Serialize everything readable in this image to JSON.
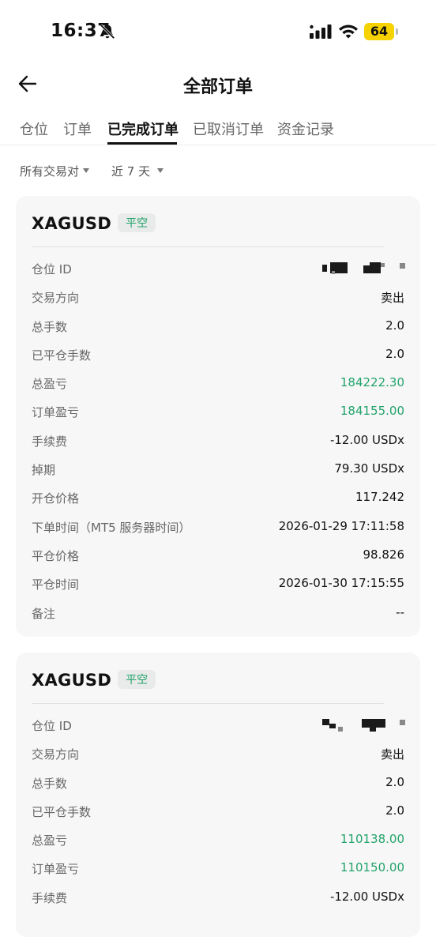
{
  "status_bar": {
    "time": "16:37",
    "battery": "64",
    "icons": [
      "bell-muted-icon",
      "signal-icon",
      "wifi-icon",
      "battery-icon"
    ]
  },
  "header": {
    "title": "全部订单",
    "back_icon": "arrow-left-icon"
  },
  "tabs": [
    {
      "label": "仓位",
      "active": false
    },
    {
      "label": "订单",
      "active": false
    },
    {
      "label": "已完成订单",
      "active": true
    },
    {
      "label": "已取消订单",
      "active": false
    },
    {
      "label": "资金记录",
      "active": false
    }
  ],
  "filters": {
    "pair": "所有交易对",
    "period": "近 7 天"
  },
  "colors": {
    "profit_green": "#22a36a",
    "battery_yellow": "#f5d200",
    "card_bg": "#f7f7f7"
  },
  "cards": [
    {
      "symbol": "XAGUSD",
      "badge": "平空",
      "rows": [
        {
          "label": "仓位 ID",
          "value": ""
        },
        {
          "label": "交易方向",
          "value": "卖出"
        },
        {
          "label": "总手数",
          "value": "2.0"
        },
        {
          "label": "已平仓手数",
          "value": "2.0"
        },
        {
          "label": "总盈亏",
          "value": "184222.30"
        },
        {
          "label": "订单盈亏",
          "value": "184155.00"
        },
        {
          "label": "手续费",
          "value": "-12.00 USDx"
        },
        {
          "label": "掉期",
          "value": "79.30 USDx"
        },
        {
          "label": "开仓价格",
          "value": "117.242"
        },
        {
          "label": "下单时间（MT5 服务器时间）",
          "value": "2026-01-29 17:11:58"
        },
        {
          "label": "平仓价格",
          "value": "98.826"
        },
        {
          "label": "平仓时间",
          "value": "2026-01-30 17:15:55"
        },
        {
          "label": "备注",
          "value": "--"
        }
      ]
    },
    {
      "symbol": "XAGUSD",
      "badge": "平空",
      "rows": [
        {
          "label": "仓位 ID",
          "value": ""
        },
        {
          "label": "交易方向",
          "value": "卖出"
        },
        {
          "label": "总手数",
          "value": "2.0"
        },
        {
          "label": "已平仓手数",
          "value": "2.0"
        },
        {
          "label": "总盈亏",
          "value": "110138.00"
        },
        {
          "label": "订单盈亏",
          "value": "110150.00"
        },
        {
          "label": "手续费",
          "value": "-12.00 USDx"
        }
      ]
    }
  ]
}
